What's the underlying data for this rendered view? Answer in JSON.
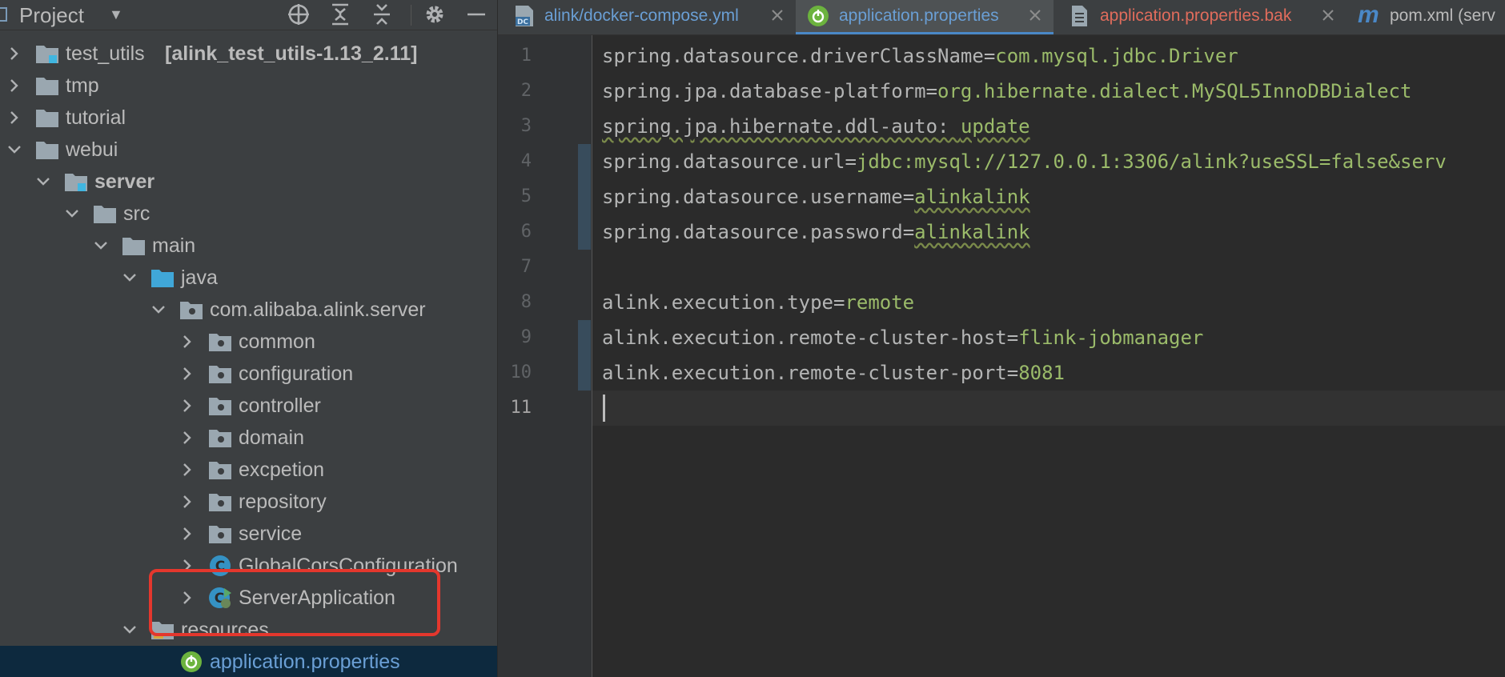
{
  "project_panel": {
    "title": "Project",
    "tree": [
      {
        "label": "test_utils",
        "suffix": "[alink_test_utils-1.13_2.11]",
        "type": "module",
        "expanded": false
      },
      {
        "label": "tmp",
        "type": "folder",
        "expanded": false
      },
      {
        "label": "tutorial",
        "type": "folder",
        "expanded": false
      },
      {
        "label": "webui",
        "type": "folder",
        "expanded": true
      },
      {
        "label": "server",
        "type": "module",
        "expanded": true
      },
      {
        "label": "src",
        "type": "folder",
        "expanded": true
      },
      {
        "label": "main",
        "type": "folder",
        "expanded": true
      },
      {
        "label": "java",
        "type": "source-folder",
        "expanded": true
      },
      {
        "label": "com.alibaba.alink.server",
        "type": "package",
        "expanded": true
      },
      {
        "label": "common",
        "type": "package",
        "expanded": false
      },
      {
        "label": "configuration",
        "type": "package",
        "expanded": false
      },
      {
        "label": "controller",
        "type": "package",
        "expanded": false
      },
      {
        "label": "domain",
        "type": "package",
        "expanded": false
      },
      {
        "label": "excpetion",
        "type": "package",
        "expanded": false
      },
      {
        "label": "repository",
        "type": "package",
        "expanded": false
      },
      {
        "label": "service",
        "type": "package",
        "expanded": false
      },
      {
        "label": "GlobalCorsConfiguration",
        "type": "class",
        "expanded": false
      },
      {
        "label": "ServerApplication",
        "type": "spring-class",
        "expanded": false
      },
      {
        "label": "resources",
        "type": "resources-folder",
        "expanded": true
      },
      {
        "label": "application.properties",
        "type": "spring-properties",
        "selected": true
      }
    ]
  },
  "tabs": [
    {
      "label": "alink/docker-compose.yml",
      "icon": "docker-compose-icon",
      "color": "#6a9fd5"
    },
    {
      "label": "application.properties",
      "icon": "spring-icon",
      "color": "#6a9fd5",
      "active": true
    },
    {
      "label": "application.properties.bak",
      "icon": "text-file-icon",
      "color": "#e06c5c"
    },
    {
      "label": "pom.xml (serv",
      "icon": "maven-icon",
      "color": "#bbbbbb"
    }
  ],
  "editor": {
    "lines": [
      {
        "num": "1",
        "key": "spring.datasource.driverClassName",
        "eq": "=",
        "value": "com.mysql.jdbc.Driver"
      },
      {
        "num": "2",
        "key": "spring.jpa.database-platform",
        "eq": "=",
        "value": "org.hibernate.dialect.MySQL5InnoDBDialect"
      },
      {
        "num": "3",
        "key": "spring.jpa.hibernate.ddl-auto",
        "eq": ": ",
        "value": "update"
      },
      {
        "num": "4",
        "key": "spring.datasource.url",
        "eq": "=",
        "value": "jdbc:mysql://127.0.0.1:3306/alink?useSSL=false&serv"
      },
      {
        "num": "5",
        "key": "spring.datasource.username",
        "eq": "=",
        "value": "alinkalink"
      },
      {
        "num": "6",
        "key": "spring.datasource.password",
        "eq": "=",
        "value": "alinkalink"
      },
      {
        "num": "7",
        "key": "",
        "eq": "",
        "value": ""
      },
      {
        "num": "8",
        "key": "alink.execution.type",
        "eq": "=",
        "value": "remote"
      },
      {
        "num": "9",
        "key": "alink.execution.remote-cluster-host",
        "eq": "=",
        "value": "flink-jobmanager"
      },
      {
        "num": "10",
        "key": "alink.execution.remote-cluster-port",
        "eq": "=",
        "value": "8081"
      },
      {
        "num": "11",
        "key": "",
        "eq": "",
        "value": ""
      }
    ],
    "current_line": "11"
  },
  "colors": {
    "panel_bg": "#3c3f41",
    "editor_bg": "#2b2b2b",
    "selection_bg": "#0d293e",
    "highlight_box": "#e4372d",
    "active_tab_underline": "#4a88c7"
  }
}
